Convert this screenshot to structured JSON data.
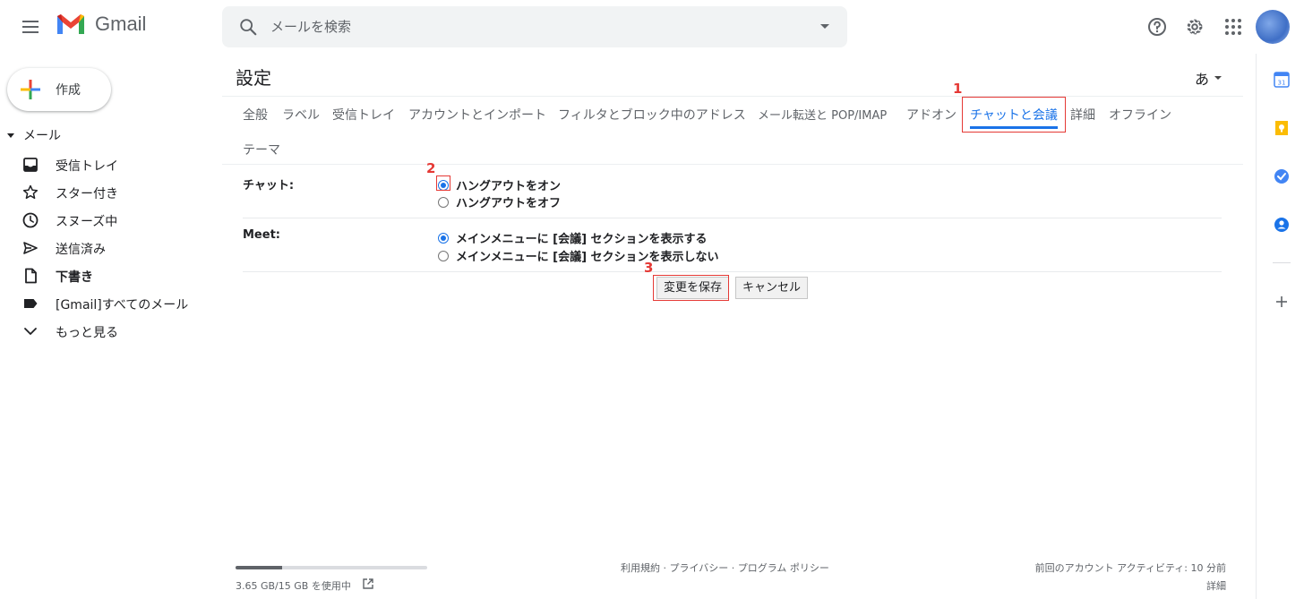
{
  "header": {
    "app_name": "Gmail",
    "search_placeholder": "メールを検索"
  },
  "sidebar": {
    "compose_label": "作成",
    "section_label": "メール",
    "items": [
      {
        "label": "受信トレイ",
        "icon": "inbox-icon"
      },
      {
        "label": "スター付き",
        "icon": "star-icon"
      },
      {
        "label": "スヌーズ中",
        "icon": "clock-icon"
      },
      {
        "label": "送信済み",
        "icon": "send-icon"
      },
      {
        "label": "下書き",
        "icon": "draft-icon"
      },
      {
        "label": "[Gmail]すべてのメール",
        "icon": "label-icon"
      },
      {
        "label": "もっと見る",
        "icon": "chevron-down-icon"
      }
    ]
  },
  "settings": {
    "title": "設定",
    "language_button": "あ",
    "tabs": [
      "全般",
      "ラベル",
      "受信トレイ",
      "アカウントとインポート",
      "フィルタとブロック中のアドレス",
      "メール転送と POP/IMAP",
      "アドオン",
      "チャットと会議",
      "詳細",
      "オフライン",
      "テーマ"
    ],
    "active_tab": "チャットと会議",
    "chat": {
      "label": "チャット:",
      "options": [
        "ハングアウトをオン",
        "ハングアウトをオフ"
      ],
      "selected": "ハングアウトをオン"
    },
    "meet": {
      "label": "Meet:",
      "options": [
        "メインメニューに [会議] セクションを表示する",
        "メインメニューに [会議] セクションを表示しない"
      ],
      "selected": "メインメニューに [会議] セクションを表示する"
    },
    "save_button": "変更を保存",
    "cancel_button": "キャンセル"
  },
  "annotations": [
    "1",
    "2",
    "3"
  ],
  "footer": {
    "storage_text": "3.65 GB/15 GB を使用中",
    "storage_fraction": 0.243,
    "links": "利用規約 · プライバシー · プログラム ポリシー",
    "activity": "前回のアカウント アクティビティ: 10 分前",
    "details": "詳細"
  },
  "colors": {
    "accent": "#1a73e8",
    "annotation_red": "#e53935"
  }
}
